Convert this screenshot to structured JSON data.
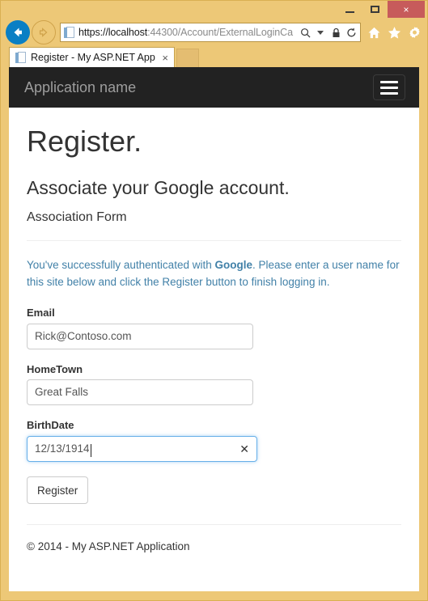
{
  "browser": {
    "window_controls": {
      "minimize_label": "Minimize",
      "maximize_label": "Maximize",
      "close_label": "×"
    },
    "nav": {
      "back_label": "Back",
      "forward_label": "Forward"
    },
    "address": {
      "scheme_host": "https://localhost",
      "rest": ":44300/Account/ExternalLoginCa",
      "search_icon": "search-icon",
      "dropdown_icon": "chevron-down-icon",
      "lock_icon": "padlock-icon",
      "refresh_icon": "refresh-icon"
    },
    "toolbar": {
      "home_icon": "home-icon",
      "favorites_icon": "star-icon",
      "settings_icon": "gear-icon"
    },
    "tab": {
      "title": "Register - My ASP.NET App...",
      "close_label": "×",
      "new_tab_label": ""
    }
  },
  "page": {
    "navbar": {
      "brand": "Application name",
      "toggle_label": "Toggle navigation"
    },
    "title": "Register.",
    "subtitle": "Associate your Google account.",
    "form_heading": "Association Form",
    "info": {
      "lead": "You've successfully authenticated with ",
      "provider": "Google",
      "tail": ". Please enter a user name for this site below and click the Register button to finish logging in."
    },
    "fields": [
      {
        "label": "Email",
        "value": "Rick@Contoso.com",
        "placeholder": "",
        "focused": false
      },
      {
        "label": "HomeTown",
        "value": "Great Falls",
        "placeholder": "",
        "focused": false
      },
      {
        "label": "BirthDate",
        "value": "12/13/1914",
        "placeholder": "",
        "focused": true,
        "clear_label": "✕"
      }
    ],
    "submit_label": "Register",
    "footer": "© 2014 - My ASP.NET Application"
  },
  "colors": {
    "window_chrome": "#edc877",
    "navbar_bg": "#222222",
    "brand_text": "#9d9d9d",
    "info_text": "#4281a8",
    "focus_border": "#66afe9",
    "close_button": "#c75b5b",
    "back_button": "#0a7fc4"
  }
}
